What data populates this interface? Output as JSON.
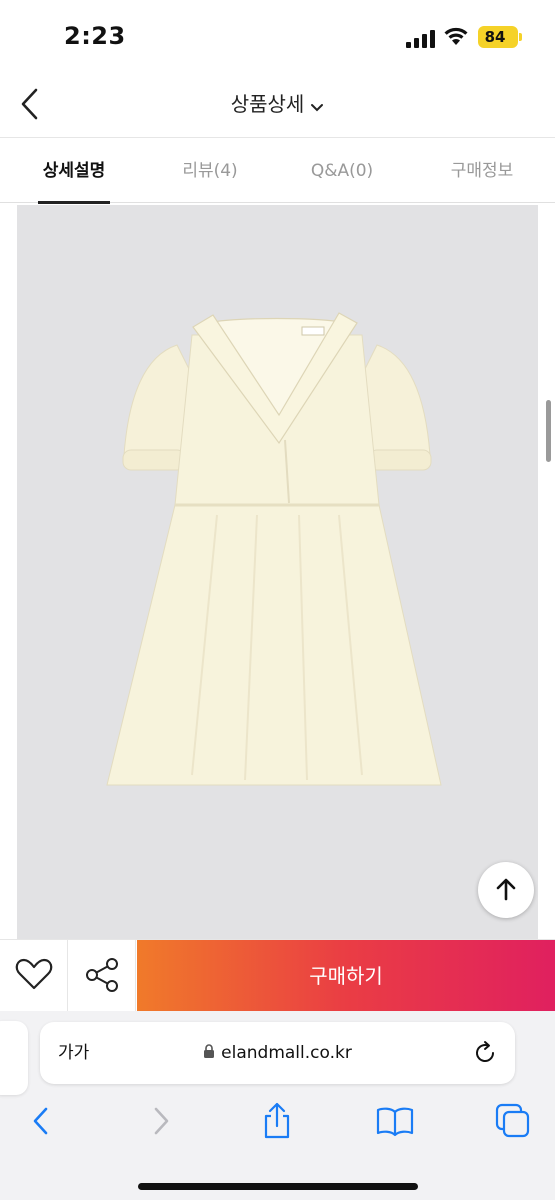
{
  "status_bar": {
    "time": "2:23",
    "battery": "84",
    "battery_color": "#f5d228"
  },
  "header": {
    "title": "상품상세",
    "back_icon": "chevron-left-icon",
    "dropdown_icon": "chevron-down-icon"
  },
  "tabs": [
    {
      "label": "상세설명",
      "active": true
    },
    {
      "label": "리뷰(4)",
      "active": false
    },
    {
      "label": "Q&A(0)",
      "active": false
    },
    {
      "label": "구매정보",
      "active": false
    }
  ],
  "product": {
    "image_description_icon": "dress-photo"
  },
  "action_bar": {
    "like_icon": "heart-icon",
    "share_icon": "share-icon",
    "buy_label": "구매하기",
    "buy_gradient": [
      "#f07a2a",
      "#ea3d44",
      "#e0205f"
    ]
  },
  "browser": {
    "aa_label": "가가",
    "url": "elandmall.co.kr",
    "reload_icon": "reload-icon",
    "nav_icons": [
      "back-icon",
      "forward-icon",
      "share-icon",
      "bookmarks-icon",
      "tabs-icon"
    ],
    "accent_color": "#1a7cf5"
  }
}
